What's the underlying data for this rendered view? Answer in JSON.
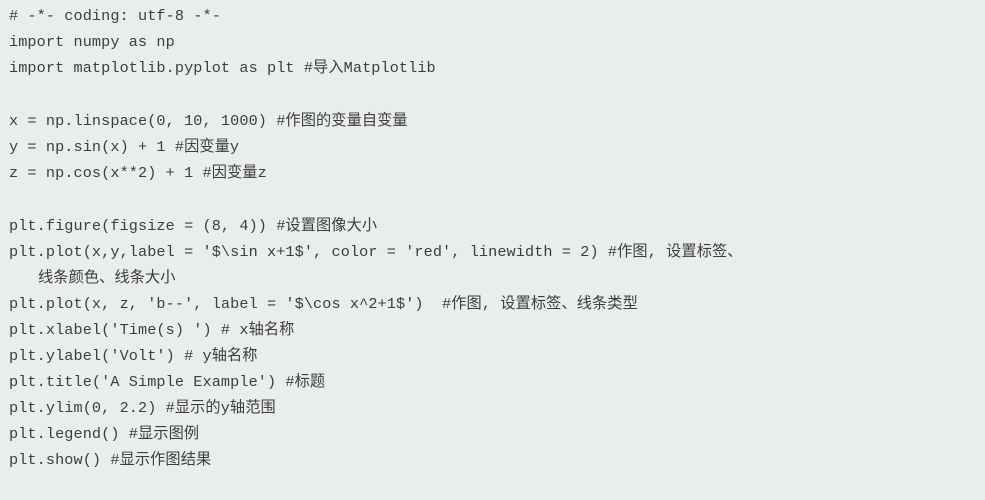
{
  "code": {
    "lines": [
      "# -*- coding: utf-8 -*-",
      "import numpy as np",
      "import matplotlib.pyplot as plt #导入Matplotlib",
      "",
      "x = np.linspace(0, 10, 1000) #作图的变量自变量",
      "y = np.sin(x) + 1 #因变量y",
      "z = np.cos(x**2) + 1 #因变量z",
      "",
      "plt.figure(figsize = (8, 4)) #设置图像大小",
      "plt.plot(x,y,label = '$\\sin x+1$', color = 'red', linewidth = 2) #作图, 设置标签、",
      "线条颜色、线条大小",
      "plt.plot(x, z, 'b--', label = '$\\cos x^2+1$')  #作图, 设置标签、线条类型",
      "plt.xlabel('Time(s) ') # x轴名称",
      "plt.ylabel('Volt') # y轴名称",
      "plt.title('A Simple Example') #标题",
      "plt.ylim(0, 2.2) #显示的y轴范围",
      "plt.legend() #显示图例",
      "plt.show() #显示作图结果"
    ]
  }
}
